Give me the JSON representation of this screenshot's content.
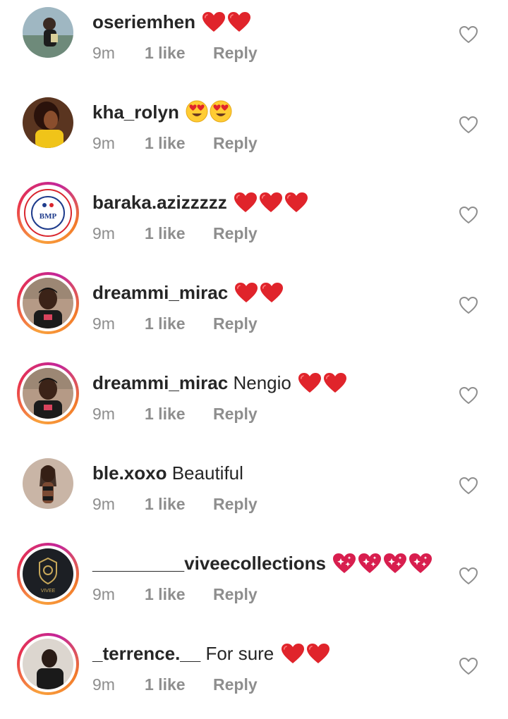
{
  "colors": {
    "text": "#262626",
    "meta": "#8e8e8e",
    "heart": "#e0242b",
    "story_ring": "#e8334d"
  },
  "comments": [
    {
      "username": "oseriemhen",
      "text": "",
      "emojis": [
        "red-heart-emoji",
        "red-heart-emoji"
      ],
      "time": "9m",
      "likes": "1 like",
      "reply": "Reply",
      "story_ring": false
    },
    {
      "username": "kha_rolyn",
      "text": "",
      "emojis": [
        "heart-eyes-emoji",
        "heart-eyes-emoji"
      ],
      "time": "9m",
      "likes": "1 like",
      "reply": "Reply",
      "story_ring": false
    },
    {
      "username": "baraka.azizzzzz",
      "text": "",
      "emojis": [
        "red-heart-emoji",
        "red-heart-emoji",
        "red-heart-emoji"
      ],
      "time": "9m",
      "likes": "1 like",
      "reply": "Reply",
      "story_ring": true,
      "avatar_text": "BMP"
    },
    {
      "username": "dreammi_mirac",
      "text": "",
      "emojis": [
        "red-heart-emoji",
        "red-heart-emoji"
      ],
      "time": "9m",
      "likes": "1 like",
      "reply": "Reply",
      "story_ring": true
    },
    {
      "username": "dreammi_mirac",
      "text": "Nengio",
      "emojis": [
        "red-heart-emoji",
        "red-heart-emoji"
      ],
      "time": "9m",
      "likes": "1 like",
      "reply": "Reply",
      "story_ring": true
    },
    {
      "username": "ble.xoxo",
      "text": "Beautiful",
      "emojis": [],
      "time": "9m",
      "likes": "1 like",
      "reply": "Reply",
      "story_ring": false
    },
    {
      "username": "_________viveecollections",
      "text": "",
      "emojis": [
        "sparkling-heart-emoji",
        "sparkling-heart-emoji",
        "sparkling-heart-emoji",
        "sparkling-heart-emoji"
      ],
      "time": "9m",
      "likes": "1 like",
      "reply": "Reply",
      "story_ring": true,
      "avatar_text": "VIVEE"
    },
    {
      "username": "_terrence.__",
      "text": "For sure",
      "emojis": [
        "red-heart-emoji",
        "red-heart-emoji"
      ],
      "time": "9m",
      "likes": "1 like",
      "reply": "Reply",
      "story_ring": true
    }
  ]
}
